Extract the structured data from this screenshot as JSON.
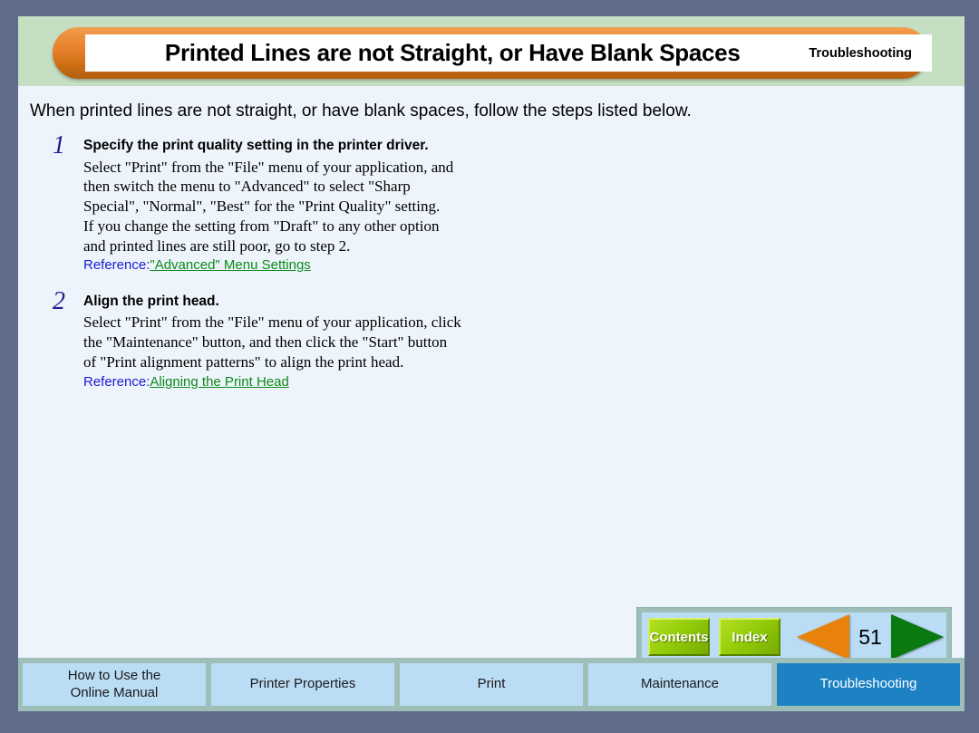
{
  "header": {
    "title": "Printed Lines are not Straight, or Have Blank Spaces",
    "section": "Troubleshooting"
  },
  "content": {
    "intro": "When printed lines are not straight, or have blank spaces, follow the steps listed below.",
    "steps": [
      {
        "number": "1",
        "title": "Specify the print quality setting in the printer driver.",
        "lines": [
          "Select \"Print\" from the \"File\" menu of your application, and",
          "then switch the menu to \"Advanced\" to select \"Sharp",
          "Special\", \"Normal\", \"Best\" for the \"Print Quality\" setting.",
          "If you change the setting from \"Draft\" to any other option",
          "and printed lines are still poor, go to step 2."
        ],
        "reference_label": "Reference:",
        "reference_link": "\"Advanced\" Menu Settings"
      },
      {
        "number": "2",
        "title": "Align the print head.",
        "lines": [
          "Select \"Print\" from the \"File\" menu of your application, click",
          "the \"Maintenance\" button, and then click the \"Start\" button",
          "of \"Print alignment patterns\" to align the print head."
        ],
        "reference_label": "Reference:",
        "reference_link": "Aligning the Print Head"
      }
    ]
  },
  "nav": {
    "contents_label": "Contents",
    "index_label": "Index",
    "page_number": "51",
    "prev_icon": "left-triangle-icon",
    "next_icon": "right-triangle-icon"
  },
  "tabs": [
    {
      "label": "How to Use the\nOnline Manual",
      "active": false
    },
    {
      "label": "Printer Properties",
      "active": false
    },
    {
      "label": "Print",
      "active": false
    },
    {
      "label": "Maintenance",
      "active": false
    },
    {
      "label": "Troubleshooting",
      "active": true
    }
  ],
  "colors": {
    "frame": "#5f6c8c",
    "page_bg": "#eef4fb",
    "header_band": "#c6dfc3",
    "banner_orange": "#e8812b",
    "tabbar_bg": "#9ebfb8",
    "tab_bg": "#bbdcf5",
    "tab_active_bg": "#1c82c4",
    "navbtn_green": "#93cc08",
    "arrow_prev": "#e8820c",
    "arrow_next": "#0a7a10",
    "link_green": "#0c8a18",
    "ref_blue": "#1b1bd0",
    "step_num_navy": "#1d1d8f"
  }
}
